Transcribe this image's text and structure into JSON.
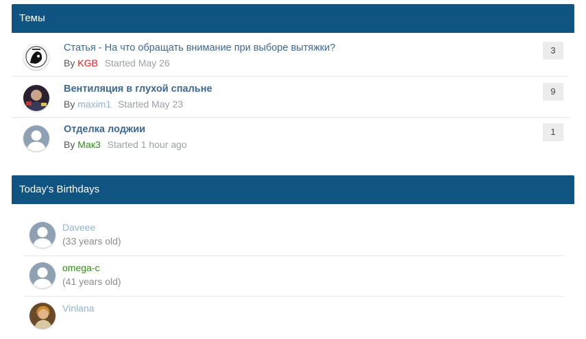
{
  "topics_widget": {
    "title": "Темы",
    "items": [
      {
        "title": "Статья - На что обращать внимание при выборе вытяжки?",
        "by": "By",
        "author": "KGB",
        "author_color": "#e0201b",
        "started": "Started May 26",
        "count": "3",
        "avatar": "black-white-face-avatar"
      },
      {
        "title": "Вентиляция в глухой спальне",
        "by": "By",
        "author": "maxim1",
        "author_color": "#8fb3d0",
        "started": "Started May 23",
        "count": "9",
        "avatar": "dark-photo-avatar"
      },
      {
        "title": "Отделка лоджии",
        "by": "By",
        "author": "Мак3",
        "author_color": "#2e8b1a",
        "started": "Started 1 hour ago",
        "count": "1",
        "avatar": "default-user-avatar"
      }
    ]
  },
  "birthdays_widget": {
    "title": "Today's Birthdays",
    "items": [
      {
        "name": "Daveee",
        "name_color": "#8fb3d0",
        "age": "(33 years old)",
        "avatar": "default-user-avatar"
      },
      {
        "name": "omega-c",
        "name_color": "#2e8b1a",
        "age": "(41 years old)",
        "avatar": "default-user-avatar"
      },
      {
        "name": "Vinlana",
        "name_color": "#8fb3d0",
        "age": "",
        "avatar": "photo-avatar"
      }
    ]
  },
  "colors": {
    "header_bg": "#0f5482",
    "title_link": "#3c6994"
  }
}
